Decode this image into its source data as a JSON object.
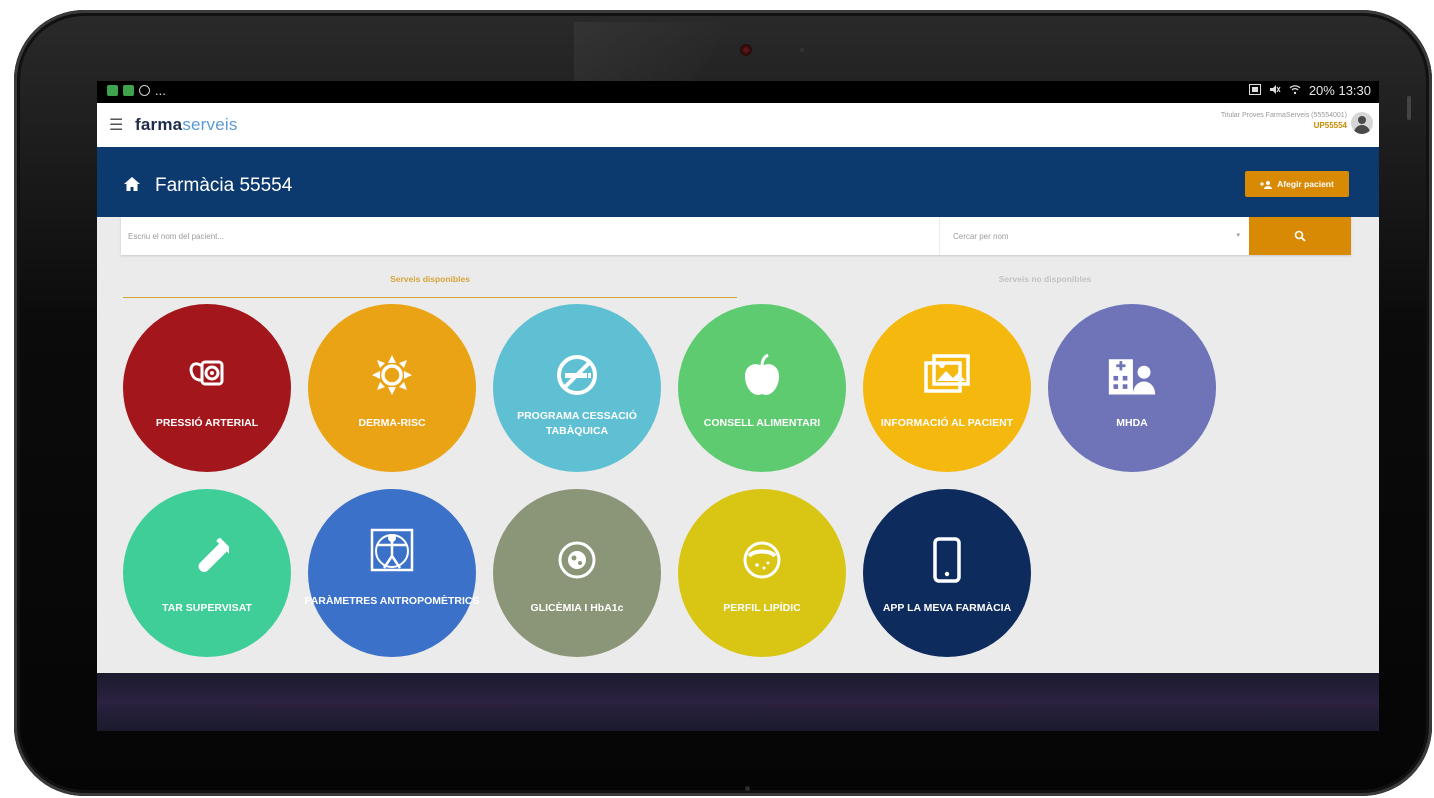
{
  "status_bar": {
    "right_text": "20% 13:30",
    "left_extra": "..."
  },
  "app": {
    "logo_bold": "farma",
    "logo_light": "serveis",
    "user_name": "Titular Proves FarmaServeis (55554001)",
    "user_code": "UP55554"
  },
  "header": {
    "title": "Farmàcia 55554",
    "add_button_label": "Afegir pacient"
  },
  "search": {
    "placeholder": "Escriu el nom del pacient...",
    "select_value": "Cercar per nom"
  },
  "tabs": [
    {
      "label": "Serveis disponibles",
      "active": true
    },
    {
      "label": "Serveis no disponibles",
      "active": false
    }
  ],
  "services": [
    {
      "label": "PRESSIÓ ARTERIAL",
      "color": "#a3161c",
      "icon": "blood-pressure-icon"
    },
    {
      "label": "DERMA-RISC",
      "color": "#e9a315",
      "icon": "sun-icon"
    },
    {
      "label": "PROGRAMA CESSACIÓ TABÀQUICA",
      "color": "#5fc0d4",
      "icon": "no-smoking-icon"
    },
    {
      "label": "CONSELL ALIMENTARI",
      "color": "#5ecb71",
      "icon": "apple-icon"
    },
    {
      "label": "INFORMACIÓ AL PACIENT",
      "color": "#f5b80f",
      "icon": "images-icon"
    },
    {
      "label": "MHDA",
      "color": "#6f74b9",
      "icon": "hospital-user-icon"
    },
    {
      "label": "TAR SUPERVISAT",
      "color": "#3fce98",
      "icon": "test-tube-icon"
    },
    {
      "label": "PARÀMETRES ANTROPOMÈTRICS",
      "color": "#3b71c8",
      "icon": "vitruvian-man-icon"
    },
    {
      "label": "GLICÈMIA I HbA1c",
      "color": "#8a9677",
      "icon": "glucose-icon"
    },
    {
      "label": "PERFIL LIPÍDIC",
      "color": "#d9c514",
      "icon": "lipid-icon"
    },
    {
      "label": "APP LA MEVA FARMÀCIA",
      "color": "#0e2b5e",
      "icon": "phone-icon"
    }
  ]
}
